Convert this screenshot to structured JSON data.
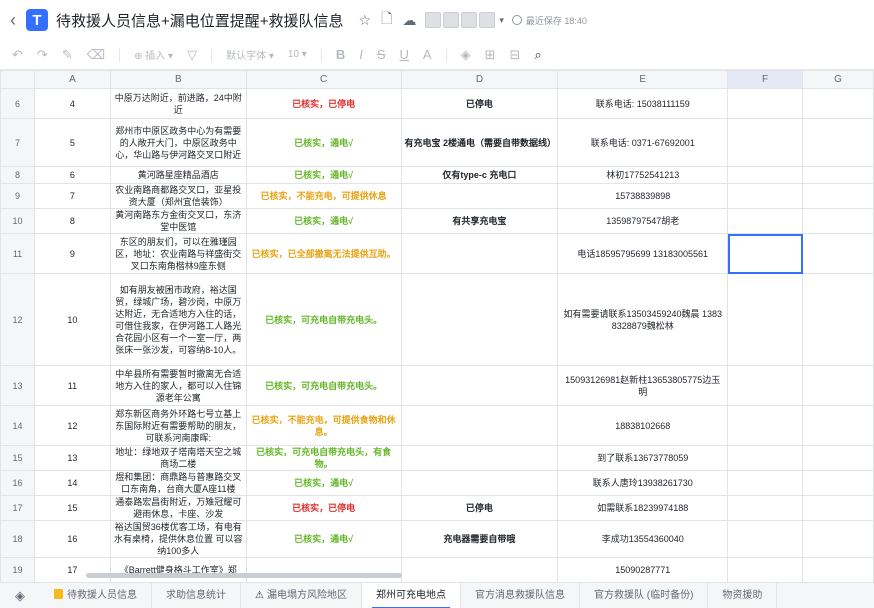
{
  "title_bar": {
    "back_icon": "chevron-left-icon",
    "doc_icon_glyph": "T",
    "title": "待救援人员信息+漏电位置提醒+救援队信息",
    "save_status": "最近保存 18:40"
  },
  "toolbar": {
    "insert_label": "插入",
    "font_label": "默认字体",
    "font_size": "10"
  },
  "columns": [
    "A",
    "B",
    "C",
    "D",
    "E",
    "F",
    "G"
  ],
  "rows": [
    {
      "num": "6",
      "a": "4",
      "b": "中原万达附近，前进路，24中附近",
      "c": "已核实，已停电",
      "c_color": "red",
      "d": "已停电",
      "e": "联系电话: 15038111159"
    },
    {
      "num": "7",
      "a": "5",
      "b": "郑州市中原区政务中心为有需要的人敞开大门，中原区政务中心，华山路与伊河路交叉口附近",
      "c": "已核实，通电√",
      "c_color": "green",
      "d": "有充电宝 2楼通电（需要自带数据线）",
      "e": "联系电话: 0371-67692001"
    },
    {
      "num": "8",
      "a": "6",
      "b": "黄河路星座精品酒店",
      "c": "已核实，通电√",
      "c_color": "green",
      "d": "仅有type-c 充电口",
      "e": "林初17752541213"
    },
    {
      "num": "9",
      "a": "7",
      "b": "农业南路商都路交叉口，亚星投资大厦（郑州宜信装饰）",
      "c": "已核实，不能充电，可提供休息",
      "c_color": "orange",
      "d": "",
      "e": "15738839898"
    },
    {
      "num": "10",
      "a": "8",
      "b": "黄河南路东方金街交叉口，东济堂中医馆",
      "c": "已核实，通电√",
      "c_color": "green",
      "d": "有共享充电宝",
      "e": "13598797547胡老"
    },
    {
      "num": "11",
      "a": "9",
      "b": "东区的朋友们，可以在雅瑾园区，地址：农业南路与祥盛街交叉口东南角楷林9座东侧",
      "c": "已核实，已全部撤离无法提供互助。",
      "c_color": "orange",
      "d": "",
      "e": "电话18595795699 13183005561"
    },
    {
      "num": "12",
      "a": "10",
      "b": "如有朋友被困市政府，裕达国贸，绿城广场，碧沙岗，中原万达附近，无合适地方入住的话，可借住我家，在伊河路工人路光合花园小区有一个一室一厅，两张床一张沙发，可容纳8-10人。",
      "c": "已核实，可充电自带充电头。",
      "c_color": "green",
      "d": "",
      "e": "如有需要请联系13503459240魏晨 13838328879魏松林"
    },
    {
      "num": "13",
      "a": "11",
      "b": "中牟县所有需要暂时撤离无合适地方入住的家人，都可以入住锦源老年公寓",
      "c": "已核实，可充电自带充电头。",
      "c_color": "green",
      "d": "",
      "e": "15093126981赵新柱13653805775边玉明"
    },
    {
      "num": "14",
      "a": "12",
      "b": "郑东新区商务外环路七号立基上东国际附近有需要帮助的朋友，可联系河南康晖:",
      "c": "已核实，不能充电，可提供食物和休息。",
      "c_color": "orange",
      "d": "",
      "e": "18838102668"
    },
    {
      "num": "15",
      "a": "13",
      "b": "地址：绿地双子塔南塔天空之城商场二楼",
      "c": "已核实，可充电自带充电头，有食物。",
      "c_color": "green",
      "d": "",
      "e": "到了联系13673778059"
    },
    {
      "num": "16",
      "a": "14",
      "b": "煜和集团：商鼎路与普惠路交叉口东南角，台商大厦A座11楼",
      "c": "已核实，通电√",
      "c_color": "green",
      "d": "",
      "e": "联系人唐玲13938261730"
    },
    {
      "num": "17",
      "a": "15",
      "b": "通泰路宏昌街附近，万雉冠耀可避雨休息，卡座、沙发",
      "c": "已核实，已停电",
      "c_color": "red",
      "d": "已停电",
      "e": "如需联系18239974188"
    },
    {
      "num": "18",
      "a": "16",
      "b": "裕达国贸36楼优客工场，有电有水有桌椅，提供休息位置 可以容纳100多人",
      "c": "已核实，通电√",
      "c_color": "green",
      "d": "充电器需要自带哦",
      "e": "李成功13554360040"
    },
    {
      "num": "19",
      "a": "17",
      "b": "《Barrett健身格斗工作室》郑",
      "c": "",
      "c_color": "green",
      "d": "",
      "e": "15090287771"
    }
  ],
  "sheet_tabs": [
    {
      "label": "待救援人员信息",
      "active": false,
      "icon": "yellow-sheet-icon"
    },
    {
      "label": "求助信息统计",
      "active": false,
      "icon": ""
    },
    {
      "label": "漏电塌方风险地区",
      "active": false,
      "icon": "warning-icon"
    },
    {
      "label": "郑州可充电地点",
      "active": true,
      "icon": ""
    },
    {
      "label": "官方消息救援队信息",
      "active": false,
      "icon": ""
    },
    {
      "label": "官方救援队 (临时备份)",
      "active": false,
      "icon": ""
    },
    {
      "label": "物资援助",
      "active": false,
      "icon": ""
    }
  ],
  "selected_cell": "F11",
  "colors": {
    "accent": "#3370ff",
    "status_red": "#e22d2d",
    "status_green": "#66b72b",
    "status_orange": "#e8a315"
  }
}
